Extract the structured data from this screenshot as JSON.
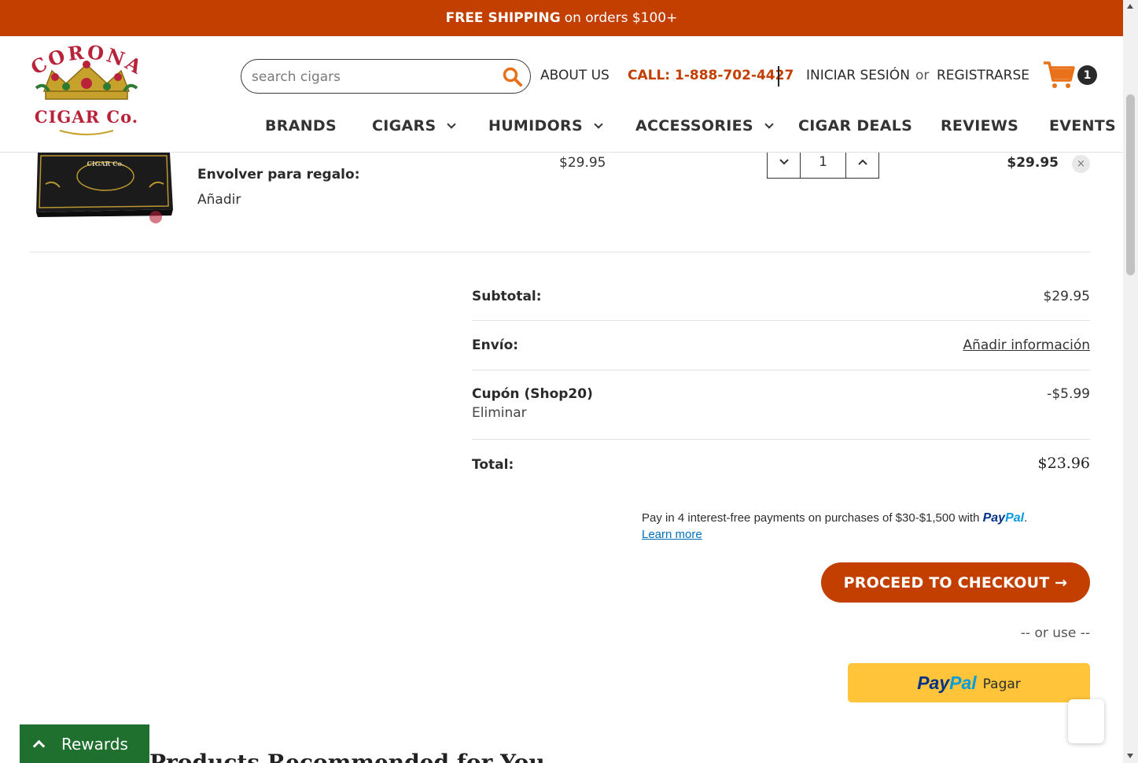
{
  "promo": {
    "bold": "FREE SHIPPING",
    "rest": "on orders $100+"
  },
  "logo": {
    "line1": "CORONA",
    "line2": "CIGAR Co."
  },
  "search": {
    "placeholder": "search cigars"
  },
  "header_links": {
    "about": "ABOUT US",
    "call": "CALL: 1-888-702-4427",
    "login": "INICIAR SESIÓN",
    "or": "or",
    "register": "REGISTRARSE",
    "cart_count": "1"
  },
  "nav": [
    {
      "label": "BRANDS",
      "dropdown": false
    },
    {
      "label": "CIGARS",
      "dropdown": true
    },
    {
      "label": "HUMIDORS",
      "dropdown": true
    },
    {
      "label": "ACCESSORIES",
      "dropdown": true
    },
    {
      "label": "CIGAR DEALS",
      "dropdown": false
    },
    {
      "label": "REVIEWS",
      "dropdown": false
    },
    {
      "label": "EVENTS",
      "dropdown": false
    }
  ],
  "cart_item": {
    "thumb_text": "CIGAR Co.",
    "gift_label": "Envolver para regalo:",
    "gift_action": "Añadir",
    "unit_price": "$29.95",
    "quantity": "1",
    "line_total": "$29.95",
    "remove_glyph": "×"
  },
  "totals": {
    "subtotal_label": "Subtotal:",
    "subtotal_value": "$29.95",
    "shipping_label": "Envío:",
    "shipping_value": "Añadir información",
    "coupon_label": "Cupón (Shop20)",
    "coupon_remove": "Eliminar",
    "coupon_value": "-$5.99",
    "total_label": "Total:",
    "total_value": "$23.96"
  },
  "paylater": {
    "text": "Pay in 4 interest-free payments on purchases of $30-$1,500 with",
    "brand_a": "Pay",
    "brand_b": "Pal",
    "period": ".",
    "learn_more": "Learn more"
  },
  "checkout": {
    "label": "PROCEED TO CHECKOUT →",
    "or_use": "-- or use --"
  },
  "paypal_button": {
    "brand_a": "Pay",
    "brand_b": "Pal",
    "action": "Pagar"
  },
  "recommended_heading": "Products Recommended for You",
  "rewards": {
    "label": "Rewards"
  },
  "colors": {
    "accent": "#c23f00",
    "rewards": "#1f6f2e",
    "paypal_yellow": "#ffc439",
    "paypal_navy": "#003087"
  },
  "icons": {
    "search": "search-icon",
    "cart": "cart-icon",
    "remove": "close-icon",
    "rewards": "chevron-up-icon"
  }
}
